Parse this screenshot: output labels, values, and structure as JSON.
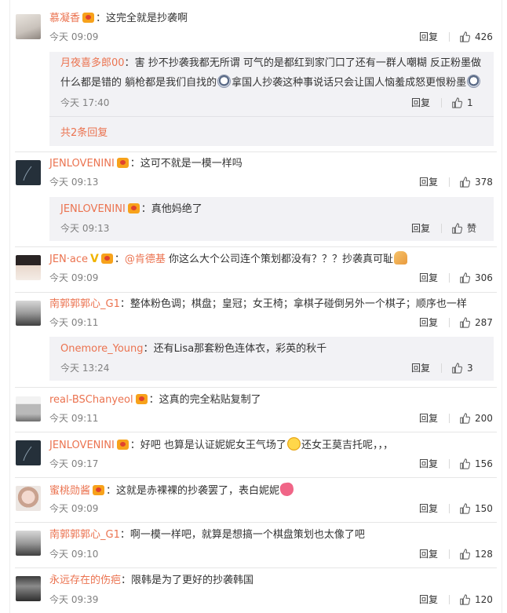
{
  "reply_label": "回复",
  "like_icon": "thumbs-up-icon",
  "comments": [
    {
      "user": "慕凝香",
      "text": "这完全就是抄袭啊",
      "time": "今天 09:09",
      "likes": "426",
      "sub": {
        "user": "月夜喜多郎00",
        "text1": "害 抄不抄袭我都无所谓 可气的是都红到家门口了还有一群人嘲糊 反正粉墨做",
        "text2a": "什么都是错的 躺枪都是我们自找的",
        "text2b": "拿国人抄袭这种事说话只会让国人恼羞成怒更恨粉墨",
        "time": "今天 17:40",
        "likes": "1",
        "more": "共2条回复"
      }
    },
    {
      "user": "JENLOVENINI",
      "text": "这可不就是一模一样吗",
      "time": "今天 09:13",
      "likes": "378",
      "sub": {
        "user": "JENLOVENINI",
        "text": "真他妈绝了",
        "time": "今天 09:13",
        "likes": "赞"
      }
    },
    {
      "user": "JEN·ace",
      "mention": "@肯德基",
      "text": "你这么大个公司连个策划都没有？？？抄袭真可耻",
      "time": "今天 09:09",
      "likes": "306"
    },
    {
      "user": "南郭郭郭心_G1",
      "text": "整体粉色调；棋盘；皇冠；女王椅；拿棋子碰倒另外一个棋子；顺序也一样",
      "time": "今天 09:11",
      "likes": "287",
      "sub": {
        "user": "Onemore_Young",
        "text": "还有Lisa那套粉色连体衣，彩英的秋千",
        "time": "今天 13:24",
        "likes": "3"
      }
    },
    {
      "user": "real-BSChanyeol",
      "text": "这真的完全粘贴复制了",
      "time": "今天 09:11",
      "likes": "200"
    },
    {
      "user": "JENLOVENINI",
      "text": "好吧 也算是认证妮妮女王气场了",
      "text_b": "还女王莫吉托呢，，，",
      "time": "今天 09:17",
      "likes": "156"
    },
    {
      "user": "蜜桃勋酱",
      "text": "这就是赤裸裸的抄袭罢了，表白妮妮",
      "time": "今天 09:09",
      "likes": "150"
    },
    {
      "user": "南郭郭郭心_G1",
      "text": "啊一模一样吧，就算是想搞一个棋盘策划也太像了吧",
      "time": "今天 09:10",
      "likes": "128"
    },
    {
      "user": "永远存在的伤疤",
      "text": "限韩是为了更好的抄袭韩国",
      "time": "今天 09:39",
      "likes": "120"
    }
  ],
  "colors": {
    "username": "#eb7350",
    "meta": "#808080",
    "subbox": "#f2f2f5",
    "divider": "#e6e6e6"
  }
}
